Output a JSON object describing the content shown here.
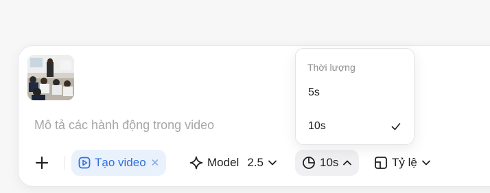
{
  "composer": {
    "prompt_placeholder": "Mô tả các hành động trong video"
  },
  "toolbar": {
    "create_video_chip": "Tạo video",
    "model_label": "Model",
    "model_value": "2.5",
    "duration_value": "10s",
    "ratio_label": "Tỷ lệ"
  },
  "duration_menu": {
    "title": "Thời lượng",
    "options": [
      "5s",
      "10s"
    ],
    "selected": "10s"
  },
  "colors": {
    "accent": "#2f6fdc",
    "chip_bg": "#e9f1fd"
  }
}
